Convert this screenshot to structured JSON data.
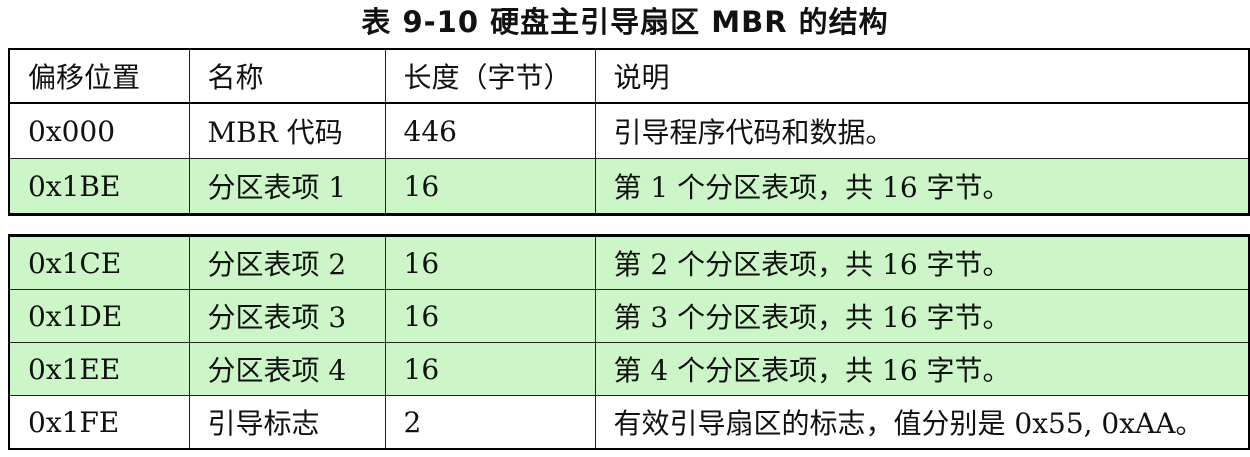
{
  "title": "表 9-10 硬盘主引导扇区 MBR 的结构",
  "table": {
    "headers": [
      "偏移位置",
      "名称",
      "长度（字节）",
      "说明"
    ],
    "rows_part1": [
      {
        "offset": "0x000",
        "name": "MBR 代码",
        "length": "446",
        "desc": "引导程序代码和数据。",
        "highlight": false
      },
      {
        "offset": "0x1BE",
        "name": "分区表项 1",
        "length": "16",
        "desc": "第 1 个分区表项，共 16 字节。",
        "highlight": true
      }
    ],
    "rows_part2": [
      {
        "offset": "0x1CE",
        "name": "分区表项 2",
        "length": "16",
        "desc": "第 2 个分区表项，共 16 字节。",
        "highlight": true
      },
      {
        "offset": "0x1DE",
        "name": "分区表项 3",
        "length": "16",
        "desc": "第 3 个分区表项，共 16 字节。",
        "highlight": true
      },
      {
        "offset": "0x1EE",
        "name": "分区表项 4",
        "length": "16",
        "desc": "第 4 个分区表项，共 16 字节。",
        "highlight": true
      },
      {
        "offset": "0x1FE",
        "name": "引导标志",
        "length": "2",
        "desc": "有效引导扇区的标志，值分别是 0x55, 0xAA。",
        "highlight": false
      }
    ]
  },
  "colors": {
    "highlight_row": "#ccf6c8",
    "border": "#000000"
  }
}
